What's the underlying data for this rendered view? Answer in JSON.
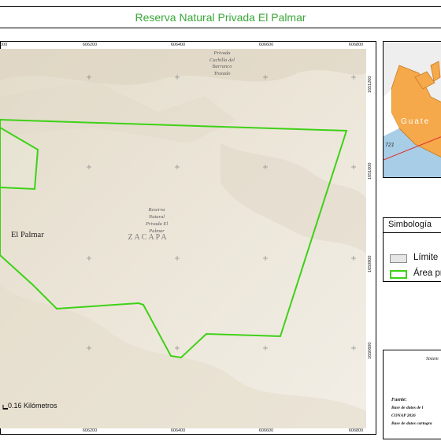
{
  "title": "Reserva Natural Privada El Palmar",
  "map": {
    "x_ticks": [
      "606000",
      "606200",
      "606400",
      "606600",
      "606800"
    ],
    "y_ticks": [
      "1651200",
      "1651000",
      "1650800",
      "1650600"
    ],
    "labels": {
      "reserve_north": [
        "Privada",
        "Cuchilla del",
        "Barranco",
        "Trozado"
      ],
      "reserve_main": [
        "Reserva",
        "Natural",
        "Privada El",
        "Palmar"
      ],
      "department": "ZACAPA",
      "place": "El Palmar"
    },
    "scale_label": "0.16 Kilómetros",
    "colors": {
      "boundary": "#3ed117",
      "terrain": "#e9e2d3"
    }
  },
  "inset": {
    "country_label": "Guate",
    "number_label": "721"
  },
  "legend": {
    "title": "Simbología",
    "items": [
      {
        "label": "Límite",
        "swatch_fill": "#e6e6e6",
        "swatch_border": "#888888"
      },
      {
        "label": "Área pr",
        "swatch_fill": "#ffffff",
        "swatch_border": "#3ed117"
      }
    ]
  },
  "notes": {
    "system_label": "Sistem",
    "source_title": "Fuente:",
    "source_lines": [
      "Base de datos de l",
      "CONAP 2026",
      "Base de datos cartogra"
    ]
  }
}
